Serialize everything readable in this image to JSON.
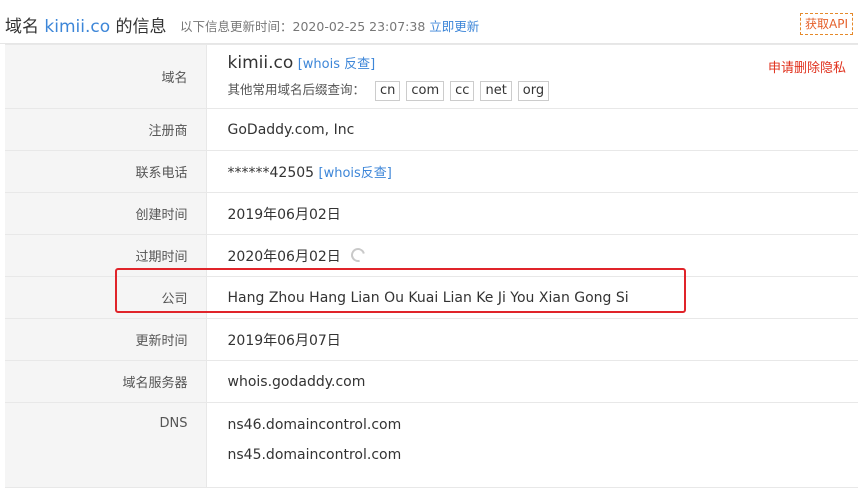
{
  "header": {
    "title_prefix": "域名",
    "title_domain": "kimii.co",
    "title_suffix": "的信息",
    "update_label": "以下信息更新时间：",
    "update_time": "2020-02-25 23:07:38",
    "refresh_link": "立即更新",
    "api_button": "获取API"
  },
  "rows": {
    "domain": {
      "label": "域名",
      "value": "kimii.co",
      "whois_link": "[whois 反查]",
      "remove_privacy": "申请删除隐私",
      "suffix_label": "其他常用域名后缀查询：",
      "suffixes": [
        "cn",
        "com",
        "cc",
        "net",
        "org"
      ]
    },
    "registrar": {
      "label": "注册商",
      "value": "GoDaddy.com, Inc"
    },
    "phone": {
      "label": "联系电话",
      "value": "******42505",
      "whois_link": "[whois反查]"
    },
    "created": {
      "label": "创建时间",
      "value": "2019年06月02日"
    },
    "expires": {
      "label": "过期时间",
      "value": "2020年06月02日"
    },
    "company": {
      "label": "公司",
      "value": "Hang Zhou Hang Lian Ou Kuai Lian Ke Ji You Xian Gong Si"
    },
    "updated": {
      "label": "更新时间",
      "value": "2019年06月07日"
    },
    "whois_server": {
      "label": "域名服务器",
      "value": "whois.godaddy.com"
    },
    "dns": {
      "label": "DNS",
      "servers": [
        "ns46.domaincontrol.com",
        "ns45.domaincontrol.com"
      ]
    }
  },
  "colors": {
    "link": "#3d86d8",
    "highlight": "#e0242a",
    "privacy": "#e0321e",
    "api": "#e5602a"
  },
  "icons": {
    "refresh": "refresh-icon"
  }
}
